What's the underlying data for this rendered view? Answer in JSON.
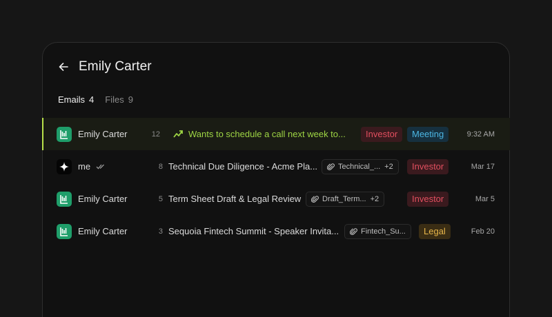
{
  "contact": {
    "name": "Emily Carter"
  },
  "tabs": [
    {
      "label": "Emails",
      "count": "4",
      "active": true
    },
    {
      "label": "Files",
      "count": "9",
      "active": false
    }
  ],
  "emails": [
    {
      "sender": "Emily Carter",
      "avatar": "green",
      "count": "12",
      "subject": "Wants to schedule a call next week to...",
      "priority_icon": "zap-icon",
      "tags": [
        "Investor",
        "Meeting"
      ],
      "time": "9:32 AM",
      "selected": true
    },
    {
      "sender": "me",
      "avatar": "black",
      "count": "8",
      "subject": "Technical Due Diligence - Acme Pla...",
      "attachment": {
        "name": "Technical_...",
        "more": "+2"
      },
      "tags": [
        "Investor"
      ],
      "time": "Mar 17"
    },
    {
      "sender": "Emily Carter",
      "avatar": "green",
      "count": "5",
      "subject": "Term Sheet Draft & Legal Review",
      "attachment": {
        "name": "Draft_Term...",
        "more": "+2"
      },
      "tags": [
        "Investor"
      ],
      "time": "Mar 5"
    },
    {
      "sender": "Emily Carter",
      "avatar": "green",
      "count": "3",
      "subject": "Sequoia Fintech Summit - Speaker Invita...",
      "attachment": {
        "name": "Fintech_Su...",
        "more": ""
      },
      "tags": [
        "Legal"
      ],
      "time": "Feb 20"
    }
  ],
  "colors": {
    "accent": "#b9e24a",
    "highlight_text": "#9ed544",
    "investor": "#e24f5f",
    "meeting": "#4cb6e3",
    "legal": "#e8b64a",
    "avatar_green": "#1f9e6a"
  }
}
